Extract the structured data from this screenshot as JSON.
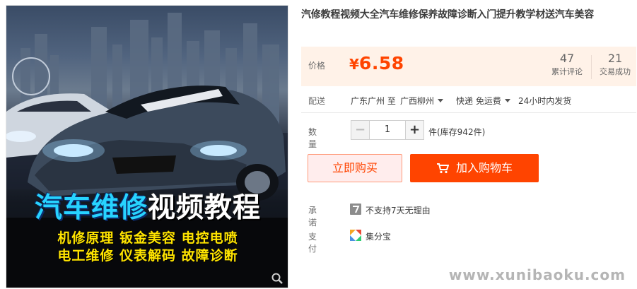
{
  "image": {
    "banner_part1": "汽车维修",
    "banner_part2": "视频教程",
    "features_line1": "机修原理 钣金美容 电控电喷",
    "features_line2": "电工维修 仪表解码 故障诊断",
    "zoom_icon": "magnifier-icon"
  },
  "product": {
    "title": "汽修教程视频大全汽车维修保养故障诊断入门提升教学材送汽车美容"
  },
  "price": {
    "label": "价格",
    "currency": "¥",
    "amount": "6.58",
    "color": "#ff4400",
    "reviews_count": "47",
    "reviews_label": "累计评论",
    "deals_count": "21",
    "deals_label": "交易成功"
  },
  "shipping": {
    "label": "配送",
    "from": "广东广州 至",
    "to": "广西柳州",
    "method": "快递 免运费",
    "dispatch": "24小时内发货"
  },
  "quantity": {
    "label": "数量",
    "minus": "−",
    "value": "1",
    "plus": "+",
    "stock": "件(库存942件)"
  },
  "buttons": {
    "buy_now": "立即购买",
    "add_to_cart": "加入购物车"
  },
  "promise": {
    "label": "承诺",
    "icon": "seven-day-return-icon",
    "text": "不支持7天无理由"
  },
  "payment": {
    "label": "支付",
    "icon": "jifenbao-icon",
    "text": "集分宝"
  },
  "watermark": "www.xunibaoku.com"
}
